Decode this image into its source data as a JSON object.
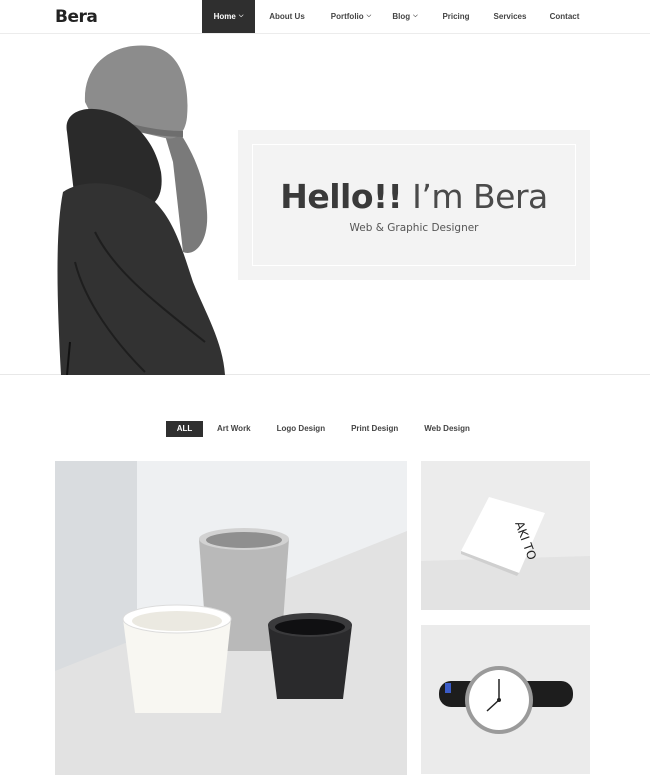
{
  "brand": {
    "logo_text": "Bera"
  },
  "nav": {
    "items": [
      {
        "label": "Home",
        "has_caret": true,
        "active": true
      },
      {
        "label": "About Us",
        "has_caret": false
      },
      {
        "label": "Portfolio",
        "has_caret": true
      },
      {
        "label": "Blog",
        "has_caret": true
      },
      {
        "label": "Pricing",
        "has_caret": false
      },
      {
        "label": "Services",
        "has_caret": false
      },
      {
        "label": "Contact",
        "has_caret": false
      }
    ],
    "caret_icon": "chevron-down-icon"
  },
  "hero": {
    "title_bold": "Hello!!",
    "title_light": "I’m Bera",
    "subtitle": "Web & Graphic Designer"
  },
  "filters": {
    "items": [
      "ALL",
      "Art Work",
      "Logo Design",
      "Print Design",
      "Web Design"
    ],
    "active": "ALL"
  },
  "portfolio": {
    "card_text": "AKI TO"
  },
  "colors": {
    "nav_active_bg": "#2f2f2f",
    "hero_box_bg": "#f3f3f3",
    "text_dark": "#3a3a3a"
  }
}
